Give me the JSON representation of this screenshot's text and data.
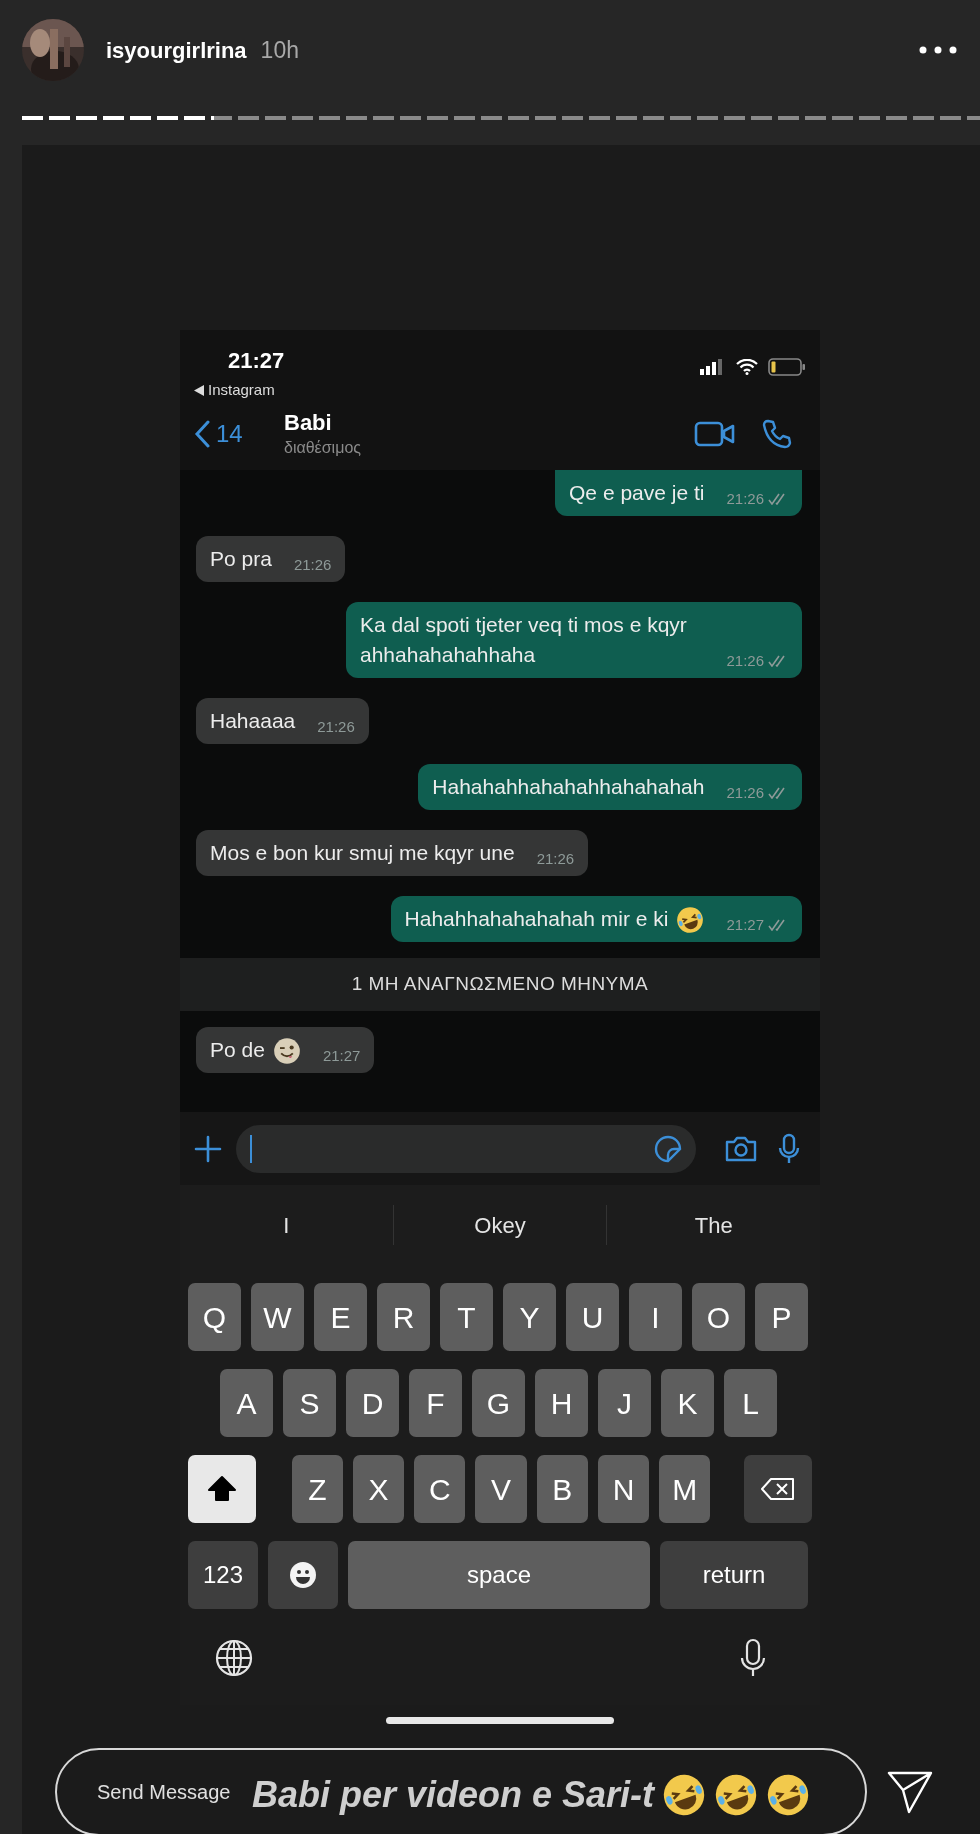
{
  "story": {
    "username": "isyourgirlrina",
    "age": "10h",
    "progress": {
      "level": 0.2
    }
  },
  "phone": {
    "status_bar": {
      "time": "21:27",
      "back_app": "Instagram"
    },
    "chat_header": {
      "back_count": "14",
      "name": "Babi",
      "presence": "διαθέσιμος"
    },
    "messages": [
      {
        "kind": "out",
        "text": "Qe e pave je ti",
        "time": "21:26"
      },
      {
        "kind": "in",
        "text": "Po pra",
        "time": "21:26"
      },
      {
        "kind": "out",
        "text": "Ka dal spoti tjeter veq ti mos e kqyr ahhahahahahhaha",
        "time": "21:26"
      },
      {
        "kind": "in",
        "text": "Hahaaaa",
        "time": "21:26"
      },
      {
        "kind": "out",
        "text": "Hahahahhahahahhahahahah",
        "time": "21:26"
      },
      {
        "kind": "in",
        "text": "Mos e bon kur smuj me kqyr une",
        "time": "21:26"
      },
      {
        "kind": "out",
        "text": "Hahahhahahahahah mir e ki",
        "emoji": {
          "kind": "rofl"
        },
        "time": "21:27"
      },
      {
        "kind": "divider",
        "text": "1 ΜΗ ΑΝΑΓΝΩΣΜΕΝΟ ΜΗΝΥΜΑ"
      },
      {
        "kind": "in",
        "text": "Po de",
        "emoji": {
          "kind": "wink"
        },
        "time": "21:27"
      }
    ],
    "keyboard": {
      "suggestions": [
        "I",
        "Okey",
        "The"
      ],
      "rows": [
        [
          "Q",
          "W",
          "E",
          "R",
          "T",
          "Y",
          "U",
          "I",
          "O",
          "P"
        ],
        [
          "A",
          "S",
          "D",
          "F",
          "G",
          "H",
          "J",
          "K",
          "L"
        ],
        [
          "Z",
          "X",
          "C",
          "V",
          "B",
          "N",
          "M"
        ]
      ],
      "shift": {
        "on": true
      },
      "numbers_key": "123",
      "space_key": "space",
      "return_key": "return"
    }
  },
  "reply": {
    "placeholder": "Send Message",
    "caption": "Babi per videon e Sari-t",
    "caption_emojis": [
      {
        "kind": "rofl"
      },
      {
        "kind": "rofl"
      },
      {
        "kind": "rofl"
      }
    ]
  }
}
